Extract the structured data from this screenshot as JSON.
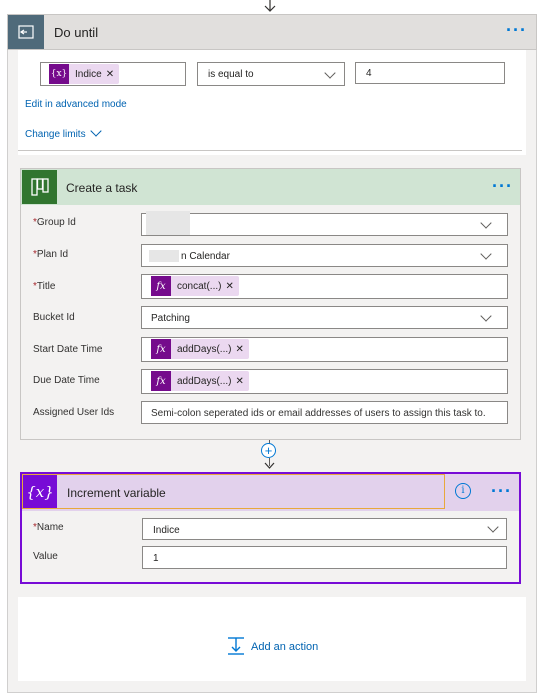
{
  "do_until": {
    "title": "Do until",
    "condition": {
      "token_label": "Indice",
      "operator": "is equal to",
      "value": "4"
    },
    "edit_advanced": "Edit in advanced mode",
    "change_limits": "Change limits"
  },
  "create_task": {
    "title": "Create a task",
    "fields": {
      "group_id": {
        "label": "Group Id",
        "required": "*",
        "value": ""
      },
      "plan_id": {
        "label": "Plan Id",
        "required": "*",
        "value": "n Calendar"
      },
      "title": {
        "label": "Title",
        "required": "*",
        "token": "concat(...)"
      },
      "bucket_id": {
        "label": "Bucket Id",
        "value": "Patching"
      },
      "start_date": {
        "label": "Start Date Time",
        "token": "addDays(...)"
      },
      "due_date": {
        "label": "Due Date Time",
        "token": "addDays(...)"
      },
      "assigned": {
        "label": "Assigned User Ids",
        "placeholder": "Semi-colon seperated ids or email addresses of users to assign this task to."
      }
    }
  },
  "increment": {
    "title": "Increment variable",
    "name_label": "Name",
    "name_required": "*",
    "name_value": "Indice",
    "value_label": "Value",
    "value_value": "1"
  },
  "add_action": "Add an action",
  "colors": {
    "accent": "#0078d4",
    "planner_green": "#31752f",
    "variable_purple": "#770bd6",
    "token_bg": "#ebd8f0"
  },
  "icons": [
    "back-arrow-icon",
    "more-dots-icon",
    "variable-icon",
    "planner-icon",
    "fx-icon",
    "chevron-down-icon",
    "info-icon",
    "add-action-icon"
  ]
}
